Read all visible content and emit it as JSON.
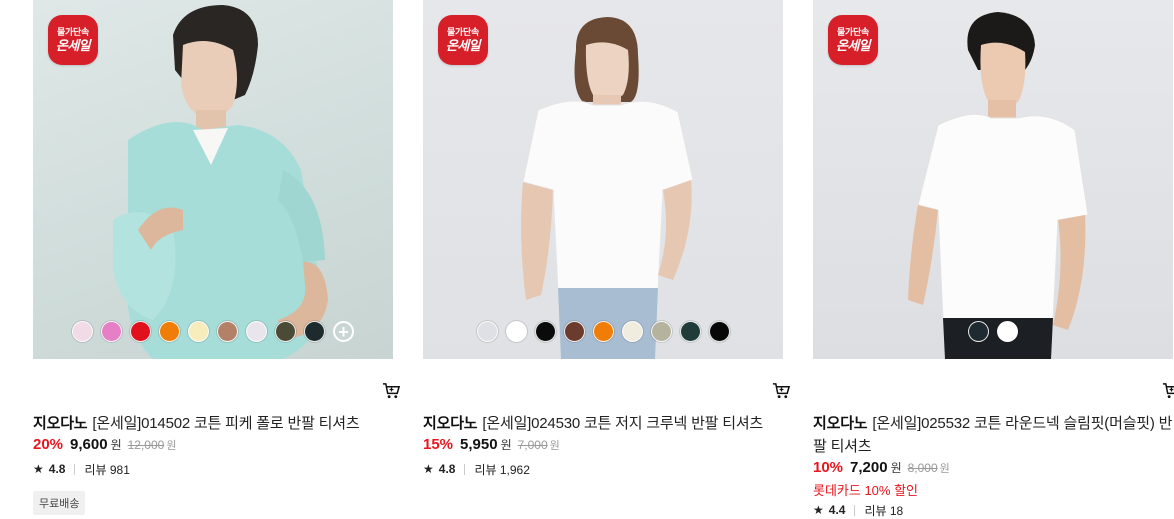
{
  "products": [
    {
      "badge": {
        "line1": "물가단속",
        "line2": "온세일"
      },
      "image_alt": "model wearing mint polo shirt",
      "brand": "지오다노",
      "name": "[온세일]014502 코튼 피케 폴로 반팔 티셔츠",
      "discount": "20%",
      "price": "9,600",
      "won": "원",
      "original_price": "12,000",
      "rating": "4.8",
      "reviews": "리뷰 981",
      "promo": "",
      "shipping": "무료배송",
      "swatches": [
        "#f1dbe6",
        "#e67fc5",
        "#e0101c",
        "#ef7d06",
        "#f6ecbc",
        "#b28168",
        "#e9e5ec",
        "#4a4a36",
        "#1d2a2e"
      ],
      "more_label": "+"
    },
    {
      "badge": {
        "line1": "물가단속",
        "line2": "온세일"
      },
      "image_alt": "model wearing white crew neck t-shirt",
      "brand": "지오다노",
      "name": "[온세일]024530 코튼 저지 크루넥 반팔 티셔츠",
      "discount": "15%",
      "price": "5,950",
      "won": "원",
      "original_price": "7,000",
      "rating": "4.8",
      "reviews": "리뷰 1,962",
      "promo": "",
      "shipping": "",
      "swatches": [
        "#dfe0e5",
        "#ffffff",
        "#0b0b0b",
        "#6b3b2e",
        "#ef7d06",
        "#f0ece0",
        "#b5b29d",
        "#1f3c3b",
        "#070707"
      ]
    },
    {
      "badge": {
        "line1": "물가단속",
        "line2": "온세일"
      },
      "image_alt": "model wearing white slim fit t-shirt",
      "brand": "지오다노",
      "name": "[온세일]025532 코튼 라운드넥 슬림핏(머슬핏) 반팔 티셔츠",
      "discount": "10%",
      "price": "7,200",
      "won": "원",
      "original_price": "8,000",
      "rating": "4.4",
      "reviews": "리뷰 18",
      "promo": "롯데카드 10% 할인",
      "shipping": "",
      "swatches": [
        "#1f2a30",
        "#ffffff"
      ]
    }
  ],
  "icons": {
    "cart": "cart-icon",
    "star": "star-icon",
    "more": "plus-circle-icon"
  }
}
